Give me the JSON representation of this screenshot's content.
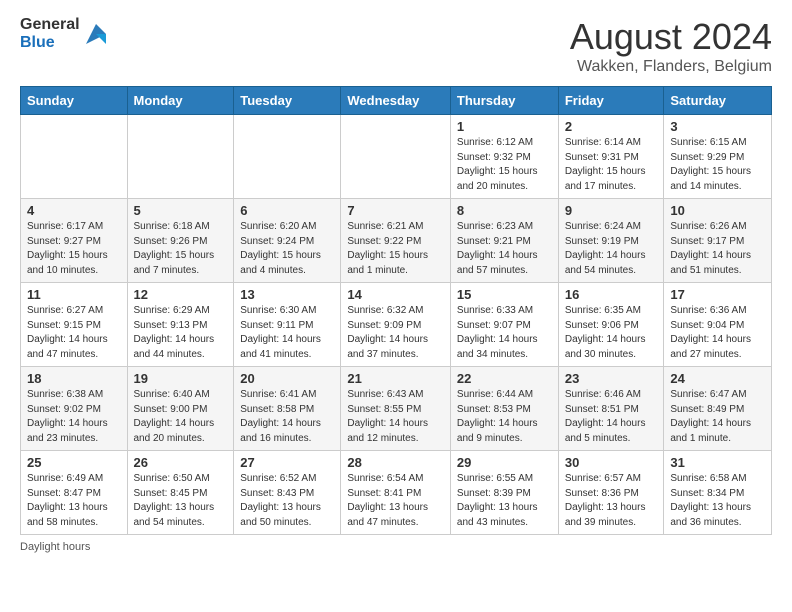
{
  "header": {
    "logo_general": "General",
    "logo_blue": "Blue",
    "main_title": "August 2024",
    "subtitle": "Wakken, Flanders, Belgium"
  },
  "days_of_week": [
    "Sunday",
    "Monday",
    "Tuesday",
    "Wednesday",
    "Thursday",
    "Friday",
    "Saturday"
  ],
  "weeks": [
    [
      {
        "day": "",
        "info": ""
      },
      {
        "day": "",
        "info": ""
      },
      {
        "day": "",
        "info": ""
      },
      {
        "day": "",
        "info": ""
      },
      {
        "day": "1",
        "info": "Sunrise: 6:12 AM\nSunset: 9:32 PM\nDaylight: 15 hours\nand 20 minutes."
      },
      {
        "day": "2",
        "info": "Sunrise: 6:14 AM\nSunset: 9:31 PM\nDaylight: 15 hours\nand 17 minutes."
      },
      {
        "day": "3",
        "info": "Sunrise: 6:15 AM\nSunset: 9:29 PM\nDaylight: 15 hours\nand 14 minutes."
      }
    ],
    [
      {
        "day": "4",
        "info": "Sunrise: 6:17 AM\nSunset: 9:27 PM\nDaylight: 15 hours\nand 10 minutes."
      },
      {
        "day": "5",
        "info": "Sunrise: 6:18 AM\nSunset: 9:26 PM\nDaylight: 15 hours\nand 7 minutes."
      },
      {
        "day": "6",
        "info": "Sunrise: 6:20 AM\nSunset: 9:24 PM\nDaylight: 15 hours\nand 4 minutes."
      },
      {
        "day": "7",
        "info": "Sunrise: 6:21 AM\nSunset: 9:22 PM\nDaylight: 15 hours\nand 1 minute."
      },
      {
        "day": "8",
        "info": "Sunrise: 6:23 AM\nSunset: 9:21 PM\nDaylight: 14 hours\nand 57 minutes."
      },
      {
        "day": "9",
        "info": "Sunrise: 6:24 AM\nSunset: 9:19 PM\nDaylight: 14 hours\nand 54 minutes."
      },
      {
        "day": "10",
        "info": "Sunrise: 6:26 AM\nSunset: 9:17 PM\nDaylight: 14 hours\nand 51 minutes."
      }
    ],
    [
      {
        "day": "11",
        "info": "Sunrise: 6:27 AM\nSunset: 9:15 PM\nDaylight: 14 hours\nand 47 minutes."
      },
      {
        "day": "12",
        "info": "Sunrise: 6:29 AM\nSunset: 9:13 PM\nDaylight: 14 hours\nand 44 minutes."
      },
      {
        "day": "13",
        "info": "Sunrise: 6:30 AM\nSunset: 9:11 PM\nDaylight: 14 hours\nand 41 minutes."
      },
      {
        "day": "14",
        "info": "Sunrise: 6:32 AM\nSunset: 9:09 PM\nDaylight: 14 hours\nand 37 minutes."
      },
      {
        "day": "15",
        "info": "Sunrise: 6:33 AM\nSunset: 9:07 PM\nDaylight: 14 hours\nand 34 minutes."
      },
      {
        "day": "16",
        "info": "Sunrise: 6:35 AM\nSunset: 9:06 PM\nDaylight: 14 hours\nand 30 minutes."
      },
      {
        "day": "17",
        "info": "Sunrise: 6:36 AM\nSunset: 9:04 PM\nDaylight: 14 hours\nand 27 minutes."
      }
    ],
    [
      {
        "day": "18",
        "info": "Sunrise: 6:38 AM\nSunset: 9:02 PM\nDaylight: 14 hours\nand 23 minutes."
      },
      {
        "day": "19",
        "info": "Sunrise: 6:40 AM\nSunset: 9:00 PM\nDaylight: 14 hours\nand 20 minutes."
      },
      {
        "day": "20",
        "info": "Sunrise: 6:41 AM\nSunset: 8:58 PM\nDaylight: 14 hours\nand 16 minutes."
      },
      {
        "day": "21",
        "info": "Sunrise: 6:43 AM\nSunset: 8:55 PM\nDaylight: 14 hours\nand 12 minutes."
      },
      {
        "day": "22",
        "info": "Sunrise: 6:44 AM\nSunset: 8:53 PM\nDaylight: 14 hours\nand 9 minutes."
      },
      {
        "day": "23",
        "info": "Sunrise: 6:46 AM\nSunset: 8:51 PM\nDaylight: 14 hours\nand 5 minutes."
      },
      {
        "day": "24",
        "info": "Sunrise: 6:47 AM\nSunset: 8:49 PM\nDaylight: 14 hours\nand 1 minute."
      }
    ],
    [
      {
        "day": "25",
        "info": "Sunrise: 6:49 AM\nSunset: 8:47 PM\nDaylight: 13 hours\nand 58 minutes."
      },
      {
        "day": "26",
        "info": "Sunrise: 6:50 AM\nSunset: 8:45 PM\nDaylight: 13 hours\nand 54 minutes."
      },
      {
        "day": "27",
        "info": "Sunrise: 6:52 AM\nSunset: 8:43 PM\nDaylight: 13 hours\nand 50 minutes."
      },
      {
        "day": "28",
        "info": "Sunrise: 6:54 AM\nSunset: 8:41 PM\nDaylight: 13 hours\nand 47 minutes."
      },
      {
        "day": "29",
        "info": "Sunrise: 6:55 AM\nSunset: 8:39 PM\nDaylight: 13 hours\nand 43 minutes."
      },
      {
        "day": "30",
        "info": "Sunrise: 6:57 AM\nSunset: 8:36 PM\nDaylight: 13 hours\nand 39 minutes."
      },
      {
        "day": "31",
        "info": "Sunrise: 6:58 AM\nSunset: 8:34 PM\nDaylight: 13 hours\nand 36 minutes."
      }
    ]
  ],
  "footer": {
    "daylight_label": "Daylight hours"
  }
}
